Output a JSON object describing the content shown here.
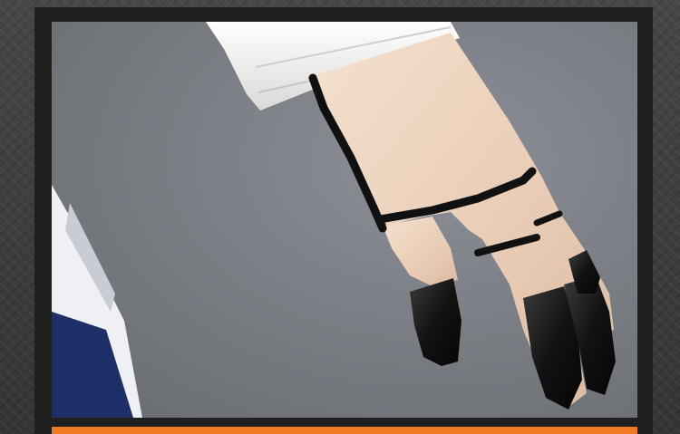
{
  "photo": {
    "subject": "sheer-mesh-glove-with-black-fingertips",
    "colors": {
      "backdrop": "#7b7f85",
      "frame": "#1f1f1f",
      "accent_banner": "#ef7a22",
      "glove_black": "#141414",
      "skin_mesh": "#e8cdb8",
      "sleeve_white": "#f4f4f2",
      "costume_navy": "#1d2f66"
    }
  },
  "banner": {
    "text": ""
  }
}
